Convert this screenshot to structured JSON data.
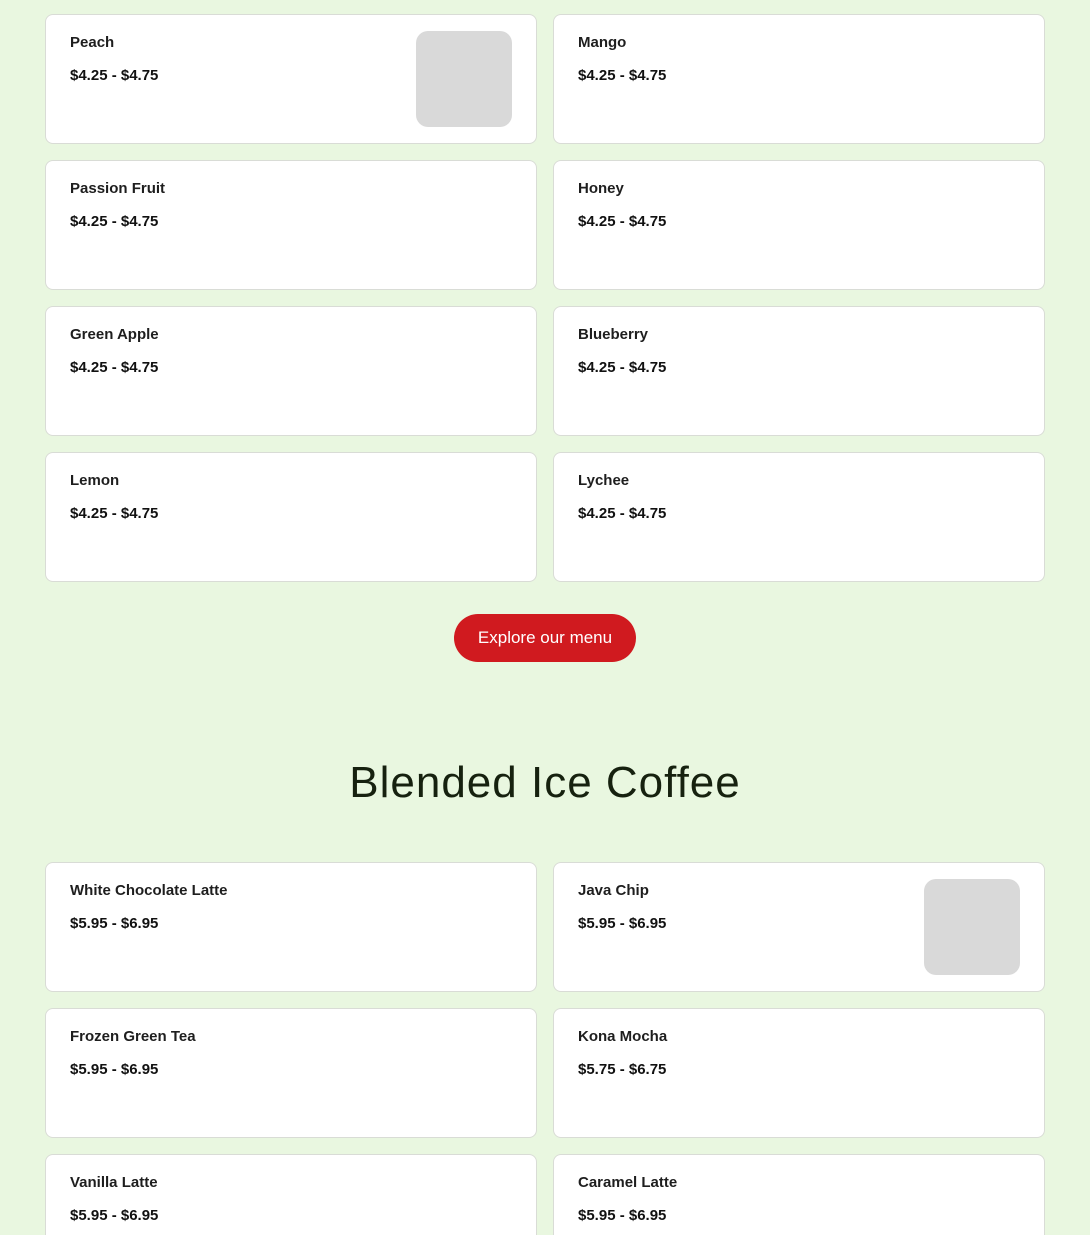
{
  "menu_cards_top": [
    {
      "name": "Peach",
      "price": "$4.25 - $4.75",
      "has_thumb": true
    },
    {
      "name": "Mango",
      "price": "$4.25 - $4.75",
      "has_thumb": false
    },
    {
      "name": "Passion Fruit",
      "price": "$4.25 - $4.75",
      "has_thumb": false
    },
    {
      "name": "Honey",
      "price": "$4.25 - $4.75",
      "has_thumb": false
    },
    {
      "name": "Green Apple",
      "price": "$4.25 - $4.75",
      "has_thumb": false
    },
    {
      "name": "Blueberry",
      "price": "$4.25 - $4.75",
      "has_thumb": false
    },
    {
      "name": "Lemon",
      "price": "$4.25 - $4.75",
      "has_thumb": false
    },
    {
      "name": "Lychee",
      "price": "$4.25 - $4.75",
      "has_thumb": false
    }
  ],
  "cta": {
    "label": "Explore our menu"
  },
  "section_blended": {
    "title": "Blended Ice Coffee",
    "cards": [
      {
        "name": "White Chocolate Latte",
        "price": "$5.95 - $6.95",
        "has_thumb": false
      },
      {
        "name": "Java Chip",
        "price": "$5.95 - $6.95",
        "has_thumb": true
      },
      {
        "name": "Frozen Green Tea",
        "price": "$5.95 - $6.95",
        "has_thumb": false
      },
      {
        "name": "Kona Mocha",
        "price": "$5.75 - $6.75",
        "has_thumb": false
      },
      {
        "name": "Vanilla Latte",
        "price": "$5.95 - $6.95",
        "has_thumb": false
      },
      {
        "name": "Caramel Latte",
        "price": "$5.95 - $6.95",
        "has_thumb": false
      }
    ]
  },
  "colors": {
    "page_background": "#e9f7e0",
    "card_background": "#ffffff",
    "card_border": "#d9dcd6",
    "cta_background": "#d01a1f",
    "cta_text": "#ffffff",
    "thumb_placeholder": "#d9d9d9"
  }
}
